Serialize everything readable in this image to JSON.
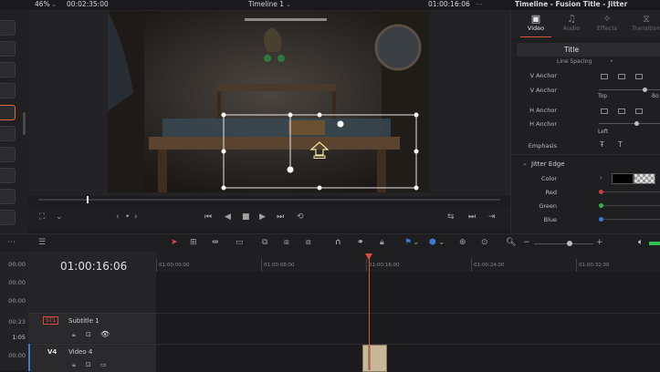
{
  "topbar": {
    "zoom": "46%",
    "timecode_left": "00:02:35:00",
    "timeline_name": "Timeline 1",
    "timecode_right": "01:00:16:06",
    "inspector_title": "Timeline - Fusion Title - Jitter"
  },
  "inspector": {
    "tabs": [
      {
        "label": "Video",
        "icon": "video-icon"
      },
      {
        "label": "Audio",
        "icon": "audio-icon"
      },
      {
        "label": "Effects",
        "icon": "effects-icon"
      },
      {
        "label": "Transition",
        "icon": "transition-icon"
      }
    ],
    "section_title": "Title",
    "clipped_label": "Line Spacing",
    "v_anchor_label": "V Anchor",
    "v_anchor_slider_label": "V Anchor",
    "v_anchor_top": "Top",
    "v_anchor_bottom": "Bo",
    "h_anchor_label": "H Anchor",
    "h_anchor_slider_label": "H Anchor",
    "h_anchor_left": "Left",
    "emphasis_label": "Emphasis",
    "jitter_edge_title": "Jitter Edge",
    "color_label": "Color",
    "red_label": "Red",
    "green_label": "Green",
    "blue_label": "Blue",
    "colors": {
      "red": "#d23a3a",
      "green": "#3ab04a",
      "blue": "#3a7ad2",
      "swatch": "#000000"
    }
  },
  "timeline": {
    "current_timecode": "01:00:16:06",
    "ruler_ticks": [
      "01:00:00:00",
      "01:00:08:00",
      "01:00:16:00",
      "01:00:24:00",
      "01:00:32:00"
    ],
    "left_timecodes": [
      "00:00",
      "00:00",
      "00:00",
      "00:23",
      "1:05",
      "00:00"
    ],
    "tracks": [
      {
        "badge": "ST1",
        "name": "Subtitle 1"
      },
      {
        "badge": "V4",
        "name": "Video 4"
      }
    ]
  }
}
